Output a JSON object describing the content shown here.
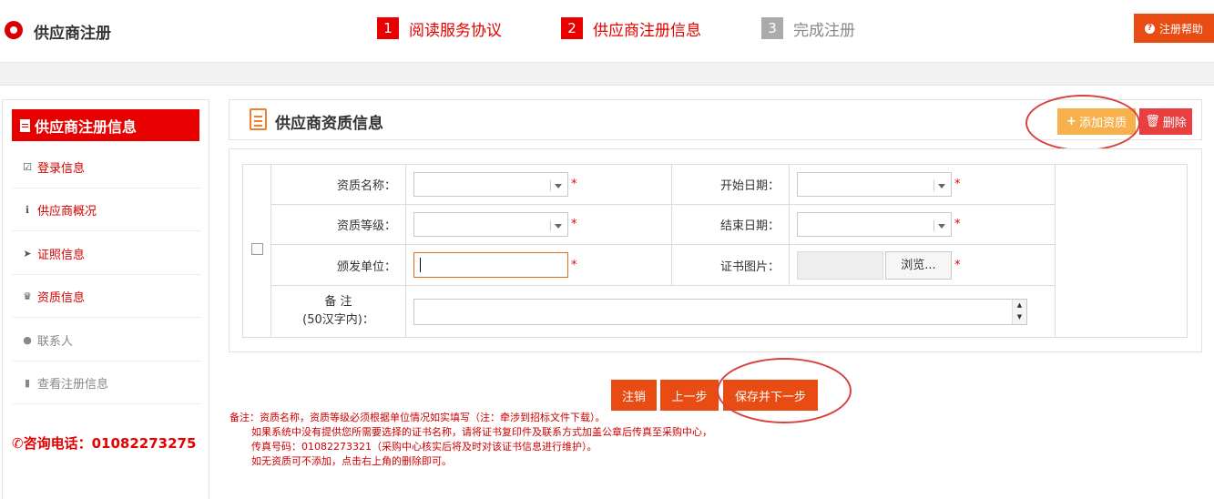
{
  "header": {
    "brand": "供应商注册",
    "steps": [
      {
        "num": "1",
        "label": "阅读服务协议"
      },
      {
        "num": "2",
        "label": "供应商注册信息"
      },
      {
        "num": "3",
        "label": "完成注册"
      }
    ],
    "help_label": "注册帮助"
  },
  "sidebar": {
    "title": "供应商注册信息",
    "items": [
      {
        "label": "登录信息",
        "icon": "check-square-icon"
      },
      {
        "label": "供应商概况",
        "icon": "info-circle-icon"
      },
      {
        "label": "证照信息",
        "icon": "paper-plane-icon"
      },
      {
        "label": "资质信息",
        "icon": "trophy-icon"
      },
      {
        "label": "联系人",
        "icon": "user-icon"
      },
      {
        "label": "查看注册信息",
        "icon": "bookmark-icon"
      }
    ],
    "phone": "咨询电话：01082273275"
  },
  "panel": {
    "title": "供应商资质信息",
    "add_label": "添加资质",
    "delete_label": "删除"
  },
  "form": {
    "qual_name_label": "资质名称：",
    "start_date_label": "开始日期：",
    "qual_level_label": "资质等级：",
    "end_date_label": "结束日期：",
    "issuer_label": "颁发单位：",
    "cert_image_label": "证书图片：",
    "browse_label": "浏览...",
    "remark_label_1": "备 注",
    "remark_label_2": "(50汉字内)：",
    "required_mark": "*"
  },
  "actions": {
    "cancel": "注销",
    "prev": "上一步",
    "save_next": "保存并下一步"
  },
  "notes": [
    "备注：资质名称，资质等级必须根据单位情况如实填写（注：牵涉到招标文件下载）。",
    "如果系统中没有提供您所需要选择的证书名称，请将证书复印件及联系方式加盖公章后传真至采购中心，",
    "传真号码：01082273321（采购中心核实后将及时对该证书信息进行维护）。",
    "如无资质可不添加，点击右上角的删除即可。"
  ],
  "colors": {
    "accent": "#e60000",
    "button": "#e84c12",
    "add": "#f7b14c"
  }
}
